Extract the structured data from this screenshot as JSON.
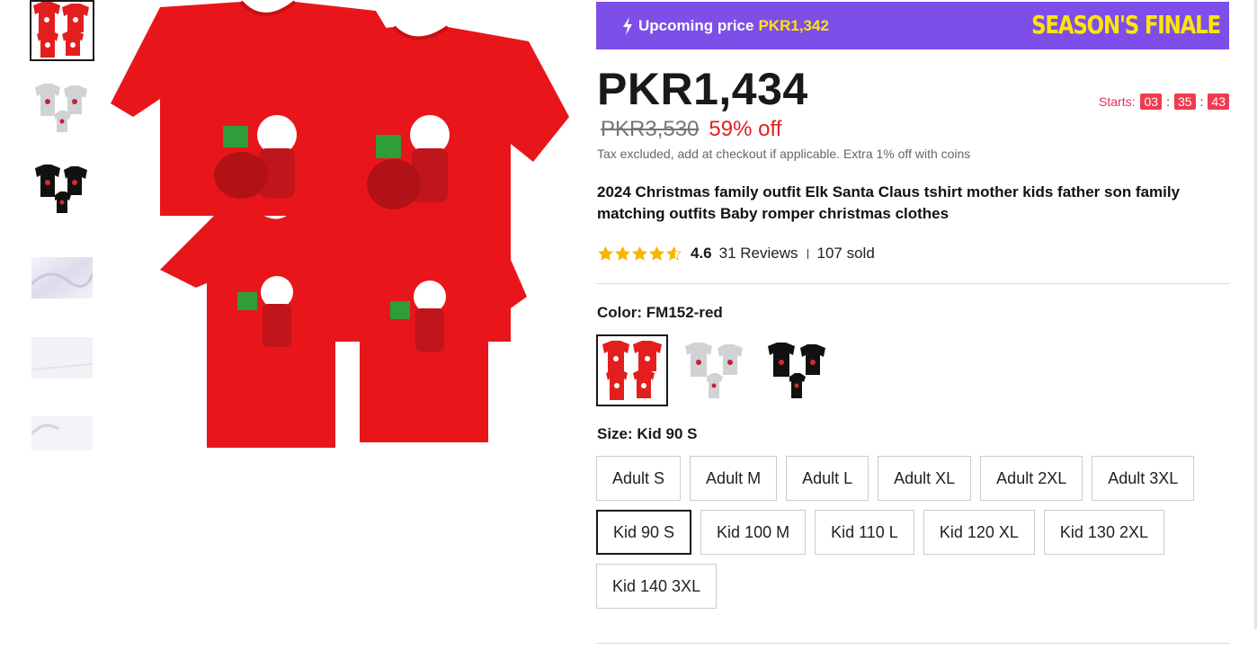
{
  "promo": {
    "label": "Upcoming price",
    "price": "PKR1,342",
    "tag": "SEASON'S FINALE",
    "accent_color": "#7d4ee8"
  },
  "price": {
    "current": "PKR1,434",
    "original": "PKR3,530",
    "discount": "59% off",
    "tax_note": "Tax excluded, add at checkout if applicable. Extra 1% off with coins"
  },
  "countdown": {
    "label": "Starts:",
    "hours": "03",
    "minutes": "35",
    "seconds": "43",
    "separator": ":"
  },
  "product": {
    "title": "2024 Christmas family outfit Elk Santa Claus tshirt mother kids father son family matching outfits Baby romper christmas clothes"
  },
  "rating": {
    "value": "4.6",
    "stars": 4.6,
    "reviews": "31 Reviews",
    "sold": "107 sold",
    "star_color": "#f7b500"
  },
  "color": {
    "label": "Color: FM152-red",
    "options": [
      "red",
      "grey",
      "black"
    ]
  },
  "size": {
    "label": "Size: Kid 90 S",
    "options": [
      "Adult S",
      "Adult M",
      "Adult L",
      "Adult XL",
      "Adult 2XL",
      "Adult 3XL",
      "Kid 90 S",
      "Kid 100 M",
      "Kid 110 L",
      "Kid 120 XL",
      "Kid 130 2XL",
      "Kid 140 3XL"
    ],
    "selected": "Kid 90 S"
  },
  "icons": {
    "promo": "bolt-icon",
    "rating": "star-icon"
  }
}
